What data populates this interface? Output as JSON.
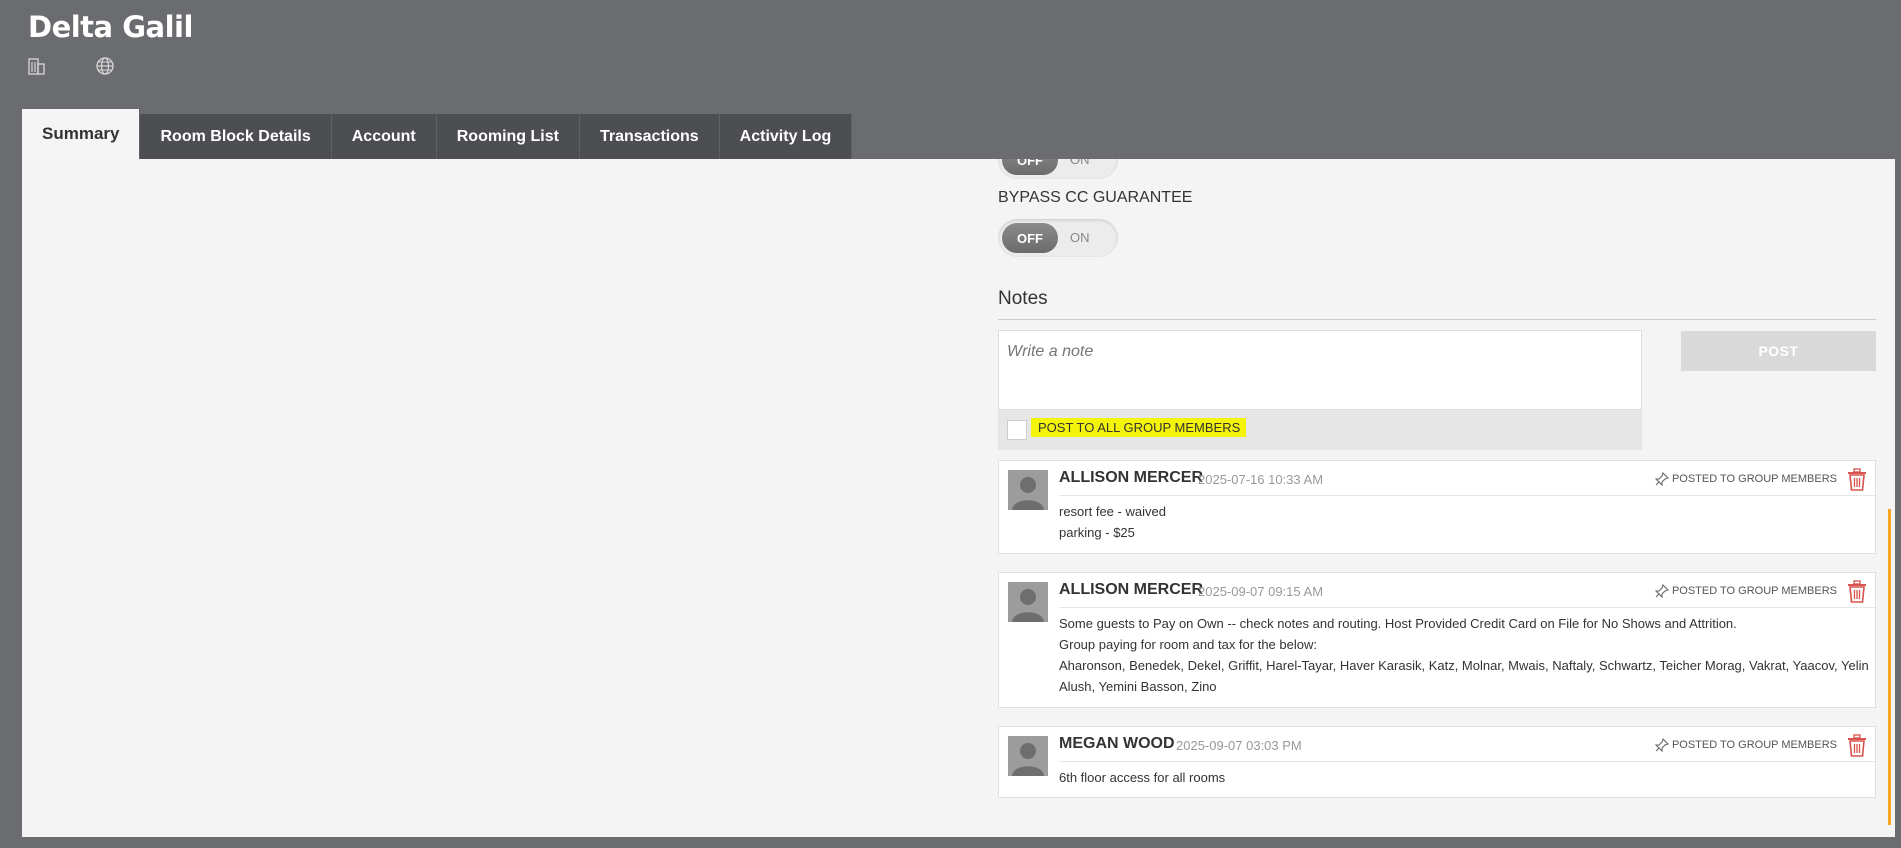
{
  "header": {
    "title": "Delta Galil",
    "icons": [
      "building-icon",
      "globe-icon"
    ]
  },
  "tabs": [
    {
      "label": "Summary",
      "active": true
    },
    {
      "label": "Room Block Details",
      "active": false
    },
    {
      "label": "Account",
      "active": false
    },
    {
      "label": "Rooming List",
      "active": false
    },
    {
      "label": "Transactions",
      "active": false
    },
    {
      "label": "Activity Log",
      "active": false
    }
  ],
  "toggles": {
    "prev": {
      "off": "OFF",
      "on": "ON"
    },
    "bypass_cc": {
      "label": "BYPASS CC GUARANTEE",
      "off": "OFF",
      "on": "ON",
      "value": "OFF"
    }
  },
  "notes": {
    "title": "Notes",
    "input_placeholder": "Write a note",
    "post_label": "POST",
    "post_all_label": "POST TO ALL GROUP MEMBERS",
    "posted_label": "POSTED TO GROUP MEMBERS",
    "items": [
      {
        "author": "ALLISON MERCER",
        "date": "2025-07-16 10:33 AM",
        "lines": [
          "resort fee - waived",
          "parking - $25"
        ]
      },
      {
        "author": "ALLISON MERCER",
        "date": "2025-09-07 09:15 AM",
        "lines": [
          "Some guests to Pay on Own -- check notes and routing. Host Provided Credit Card on File for No Shows and Attrition.",
          "Group paying for room and tax for the below:",
          "Aharonson, Benedek, Dekel, Griffit, Harel-Tayar, Haver Karasik, Katz, Molnar, Mwais, Naftaly, Schwartz, Teicher Morag, Vakrat, Yaacov, Yelin Alush, Yemini Basson, Zino"
        ]
      },
      {
        "author": "MEGAN WOOD",
        "date": "2025-09-07 03:03 PM",
        "lines": [
          "6th floor access for all rooms"
        ]
      }
    ]
  },
  "colors": {
    "header_bg": "#6b6c6f",
    "tab_bg": "#4d4e51",
    "highlight": "#f4f40a",
    "trash": "#d9534f",
    "scroll_accent": "#f5a623"
  }
}
